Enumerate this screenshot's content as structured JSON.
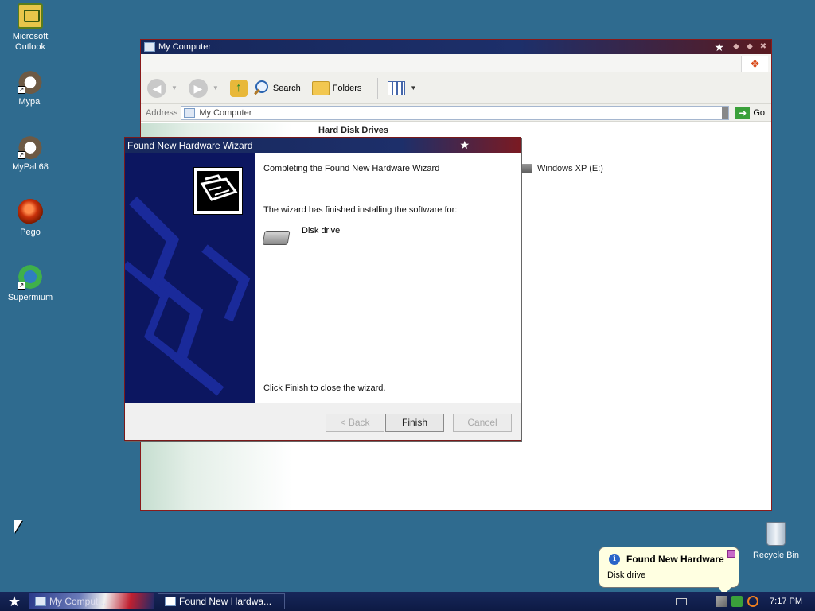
{
  "desktop": {
    "icons": [
      {
        "label": "Microsoft Outlook",
        "icon": "outlook-icon"
      },
      {
        "label": "Mypal",
        "icon": "mypal-icon"
      },
      {
        "label": "MyPal 68",
        "icon": "mypal68-icon"
      },
      {
        "label": "Pego",
        "icon": "pego-icon"
      },
      {
        "label": "Supermium",
        "icon": "supermium-icon"
      }
    ],
    "recycle_bin": "Recycle Bin"
  },
  "my_computer": {
    "title": "My Computer",
    "toolbar": {
      "search": "Search",
      "folders": "Folders"
    },
    "address": {
      "label": "Address",
      "value": "My Computer",
      "go": "Go"
    },
    "section": "Hard Disk Drives",
    "drive": "Windows XP (E:)"
  },
  "wizard": {
    "title": "Found New Hardware Wizard",
    "heading": "Completing the Found New Hardware Wizard",
    "finished_text": "The wizard has finished installing the software for:",
    "device": "Disk drive",
    "close_text": "Click Finish to close the wizard.",
    "buttons": {
      "back": "< Back",
      "finish": "Finish",
      "cancel": "Cancel"
    }
  },
  "balloon": {
    "title": "Found New Hardware",
    "text": "Disk drive"
  },
  "taskbar": {
    "tasks": [
      "My Comput...",
      "Found New Hardwa..."
    ],
    "clock": "7:17 PM"
  },
  "colors": {
    "desktop": "#2f6b8f",
    "titlebar": "#16275a",
    "wizard_side": "#0c1660",
    "balloon": "#ffffe1"
  }
}
